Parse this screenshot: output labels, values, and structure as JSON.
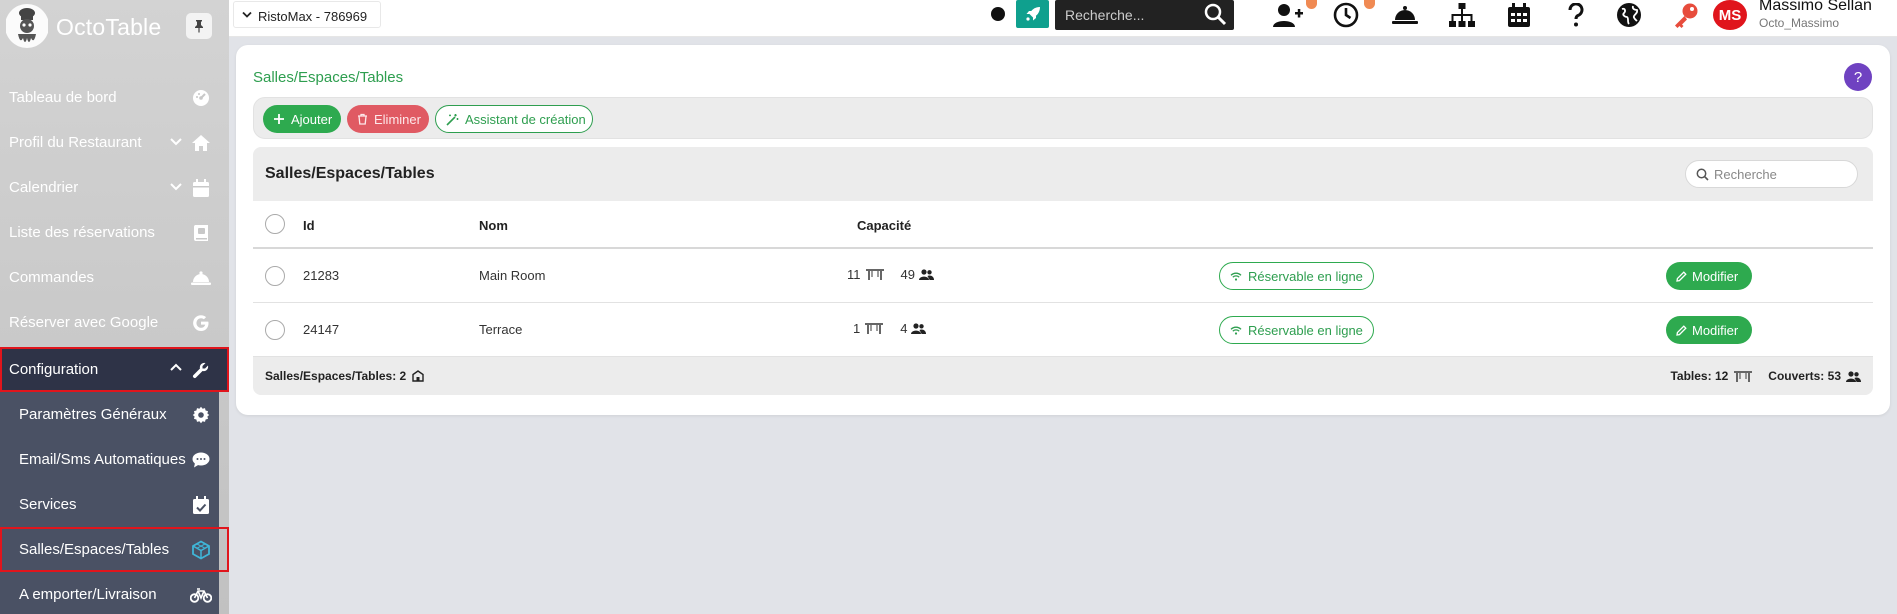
{
  "app": {
    "brand": "OctoTable"
  },
  "sidebar": {
    "items": [
      {
        "label": "Tableau de bord",
        "icon": "dashboard-gauge-icon"
      },
      {
        "label": "Profil du Restaurant",
        "icon": "home-icon",
        "expandable": true
      },
      {
        "label": "Calendrier",
        "icon": "calendar-icon",
        "expandable": true
      },
      {
        "label": "Liste des réservations",
        "icon": "book-icon"
      },
      {
        "label": "Commandes",
        "icon": "cloche-icon"
      },
      {
        "label": "Réserver avec Google",
        "icon": "google-icon"
      },
      {
        "label": "Configuration",
        "icon": "wrench-icon",
        "expanded": true,
        "highlighted": true
      }
    ],
    "submenu": [
      {
        "label": "Paramètres Généraux",
        "icon": "gear-icon"
      },
      {
        "label": "Email/Sms Automatiques",
        "icon": "chat-icon"
      },
      {
        "label": "Services",
        "icon": "calendar-check-icon"
      },
      {
        "label": "Salles/Espaces/Tables",
        "icon": "cube-icon",
        "active": true,
        "highlighted": true
      },
      {
        "label": "A emporter/Livraison",
        "icon": "bicycle-icon"
      }
    ]
  },
  "topbar": {
    "restaurant": "RistoMax - 786969",
    "search_placeholder": "Recherche...",
    "icons": [
      "status-dot",
      "rocket-icon",
      "search-icon",
      "add-user-icon",
      "clock-icon",
      "cloche-icon",
      "sitemap-icon",
      "calendar-icon",
      "question-icon",
      "globe-icon",
      "key-icon"
    ],
    "user": {
      "initials": "MS",
      "name": "Massimo Sellan",
      "login": "Octo_Massimo"
    },
    "colors": {
      "rocket": "#0fa08e",
      "avatar": "#e0151c",
      "badge": "#f08a53"
    }
  },
  "page": {
    "title": "Salles/Espaces/Tables",
    "help": "?",
    "actions": {
      "add": "Ajouter",
      "delete": "Eliminer",
      "wizard": "Assistant de création"
    }
  },
  "table": {
    "title": "Salles/Espaces/Tables",
    "search_placeholder": "Recherche",
    "columns": {
      "id": "Id",
      "name": "Nom",
      "capacity": "Capacité"
    },
    "rows": [
      {
        "id": "21283",
        "name": "Main Room",
        "tables": "11",
        "covers": "49",
        "online": "Réservable en ligne",
        "edit": "Modifier"
      },
      {
        "id": "24147",
        "name": "Terrace",
        "tables": "1",
        "covers": "4",
        "online": "Réservable en ligne",
        "edit": "Modifier"
      }
    ],
    "footer": {
      "count_label": "Salles/Espaces/Tables: 2",
      "tables_label": "Tables: 12",
      "covers_label": "Couverts: 53"
    }
  },
  "theme": {
    "green": "#2eaa4f",
    "red": "#e0151c",
    "purple": "#6f42c1",
    "sidebar_dark": "#2e3347",
    "submenu": "#4a5164"
  }
}
